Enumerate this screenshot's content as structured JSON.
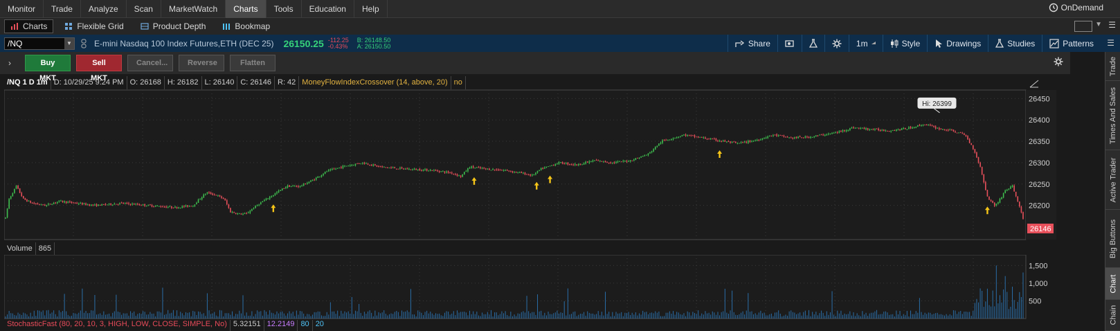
{
  "menubar": {
    "items": [
      "Monitor",
      "Trade",
      "Analyze",
      "Scan",
      "MarketWatch",
      "Charts",
      "Tools",
      "Education",
      "Help"
    ],
    "active": "Charts",
    "ondemand_label": "OnDemand"
  },
  "subbar": {
    "tabs": [
      "Charts",
      "Flexible Grid",
      "Product Depth",
      "Bookmap"
    ],
    "active": "Charts"
  },
  "symbol_bar": {
    "symbol": "/NQ",
    "description": "E-mini Nasdaq 100 Index Futures,ETH (DEC 25)",
    "last_price": "26150.25",
    "net_change": "-112.25",
    "pct_change": "-0.43%",
    "bid": "B: 26148.50",
    "ask": "A: 26150.50",
    "tools": [
      "Share",
      "",
      "",
      "",
      "1m",
      "Style",
      "Drawings",
      "Studies",
      "Patterns"
    ]
  },
  "trade_bar": {
    "buy_label": "Buy MKT",
    "sell_label": "Sell MKT",
    "cancel_label": "Cancel...",
    "reverse_label": "Reverse",
    "flatten_label": "Flatten"
  },
  "sidebar": {
    "tabs": [
      "Trade",
      "Times And Sales",
      "Active Trader",
      "Big Buttons",
      "Chart",
      "Chain"
    ],
    "active": "Chart"
  },
  "chart_info": {
    "symbol_period": "/NQ 1 D 1m",
    "date": "D: 10/29/25 9:24 PM",
    "open": "O: 26168",
    "high": "H: 26182",
    "low": "L: 26140",
    "close": "C: 26146",
    "range": "R: 42",
    "study": "MoneyFlowIndexCrossover (14, above, 20)",
    "study_value": "no"
  },
  "volume_info": {
    "label": "Volume",
    "value": "865"
  },
  "stoch_info": {
    "label": "StochasticFast (80, 20, 10, 3, HIGH, LOW, CLOSE, SIMPLE, No)",
    "v1": "5.32151",
    "v2": "12.2149",
    "v3": "80",
    "v4": "20"
  },
  "chart_data": {
    "type": "candlestick",
    "price_axis": {
      "ticks": [
        26450,
        26400,
        26350,
        26300,
        26250,
        26200
      ],
      "min": 26120,
      "max": 26470
    },
    "volume_axis": {
      "ticks": [
        "1,500",
        "1,000",
        "500"
      ],
      "tick_values": [
        1500,
        1000,
        500
      ],
      "max": 1800
    },
    "high_label": "Hi: 26399",
    "high_value": 26399,
    "last_label": "26146",
    "last_value": 26146,
    "path": [
      [
        0,
        26170
      ],
      [
        4,
        26215
      ],
      [
        12,
        26245
      ],
      [
        20,
        26215
      ],
      [
        30,
        26205
      ],
      [
        45,
        26200
      ],
      [
        60,
        26210
      ],
      [
        80,
        26205
      ],
      [
        100,
        26200
      ],
      [
        130,
        26205
      ],
      [
        160,
        26200
      ],
      [
        190,
        26195
      ],
      [
        210,
        26200
      ],
      [
        225,
        26230
      ],
      [
        235,
        26225
      ],
      [
        245,
        26215
      ],
      [
        252,
        26185
      ],
      [
        262,
        26180
      ],
      [
        270,
        26180
      ],
      [
        275,
        26190
      ],
      [
        285,
        26205
      ],
      [
        300,
        26225
      ],
      [
        315,
        26245
      ],
      [
        330,
        26245
      ],
      [
        345,
        26260
      ],
      [
        360,
        26280
      ],
      [
        380,
        26292
      ],
      [
        400,
        26300
      ],
      [
        420,
        26290
      ],
      [
        450,
        26285
      ],
      [
        480,
        26282
      ],
      [
        500,
        26276
      ],
      [
        510,
        26268
      ],
      [
        520,
        26290
      ],
      [
        540,
        26285
      ],
      [
        560,
        26282
      ],
      [
        580,
        26275
      ],
      [
        590,
        26270
      ],
      [
        600,
        26285
      ],
      [
        620,
        26300
      ],
      [
        640,
        26295
      ],
      [
        660,
        26305
      ],
      [
        680,
        26300
      ],
      [
        700,
        26305
      ],
      [
        720,
        26320
      ],
      [
        735,
        26350
      ],
      [
        760,
        26365
      ],
      [
        790,
        26355
      ],
      [
        820,
        26345
      ],
      [
        840,
        26352
      ],
      [
        860,
        26365
      ],
      [
        880,
        26358
      ],
      [
        900,
        26360
      ],
      [
        930,
        26370
      ],
      [
        950,
        26382
      ],
      [
        970,
        26378
      ],
      [
        990,
        26375
      ],
      [
        1010,
        26380
      ],
      [
        1030,
        26390
      ],
      [
        1045,
        26380
      ],
      [
        1060,
        26375
      ],
      [
        1075,
        26365
      ],
      [
        1085,
        26330
      ],
      [
        1092,
        26290
      ],
      [
        1100,
        26220
      ],
      [
        1108,
        26200
      ],
      [
        1113,
        26210
      ],
      [
        1120,
        26235
      ],
      [
        1128,
        26245
      ],
      [
        1134,
        26210
      ],
      [
        1140,
        26170
      ]
    ],
    "arrows": [
      300,
      525,
      595,
      610,
      800,
      1100
    ],
    "volume_spikes": [
      [
        1110,
        1500
      ],
      [
        1120,
        1200
      ],
      [
        1128,
        900
      ],
      [
        1140,
        1300
      ]
    ]
  },
  "colors": {
    "up": "#3fbf4f",
    "down": "#e8505b",
    "arrow": "#f5c518",
    "grid": "#3a3a3a",
    "volume": "#2a6ea8",
    "accent": "#0e2d4a"
  }
}
